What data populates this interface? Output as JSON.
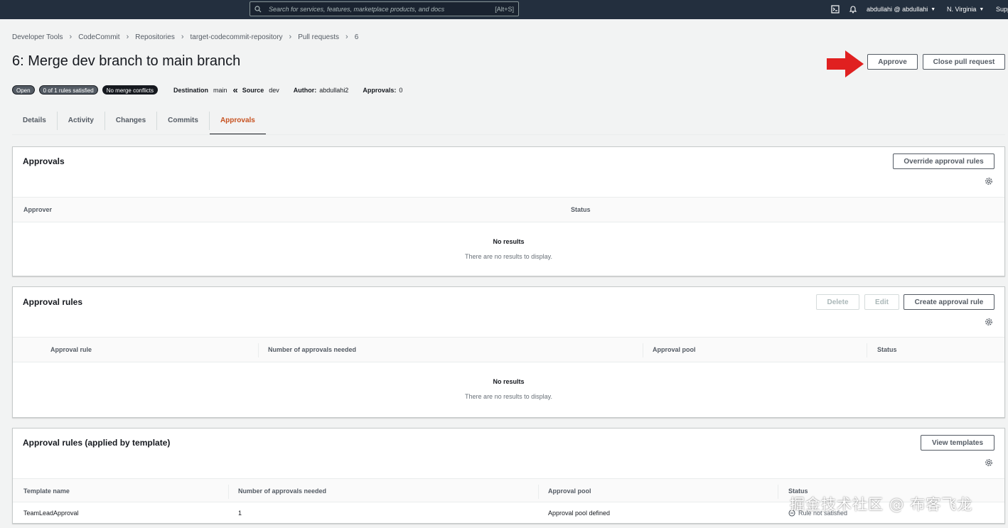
{
  "topnav": {
    "search_placeholder": "Search for services, features, marketplace products, and docs",
    "search_shortcut": "[Alt+S]",
    "account": "abdullahi @ abdullahi",
    "region": "N. Virginia",
    "support": "Supp"
  },
  "breadcrumb": [
    "Developer Tools",
    "CodeCommit",
    "Repositories",
    "target-codecommit-repository",
    "Pull requests",
    "6"
  ],
  "page": {
    "title": "6: Merge dev branch to main branch",
    "approve_label": "Approve",
    "close_label": "Close pull request"
  },
  "status": {
    "open": "Open",
    "rules": "0 of 1 rules satisfied",
    "conflicts": "No merge conflicts",
    "destination_label": "Destination",
    "destination_value": "main",
    "source_label": "Source",
    "source_value": "dev",
    "author_label": "Author:",
    "author_value": "abdullahi2",
    "approvals_label": "Approvals:",
    "approvals_value": "0"
  },
  "tabs": [
    "Details",
    "Activity",
    "Changes",
    "Commits",
    "Approvals"
  ],
  "approvals_panel": {
    "title": "Approvals",
    "override_label": "Override approval rules",
    "columns": [
      "Approver",
      "Status"
    ],
    "empty_title": "No results",
    "empty_sub": "There are no results to display."
  },
  "rules_panel": {
    "title": "Approval rules",
    "delete_label": "Delete",
    "edit_label": "Edit",
    "create_label": "Create approval rule",
    "columns": [
      "Approval rule",
      "Number of approvals needed",
      "Approval pool",
      "Status"
    ],
    "empty_title": "No results",
    "empty_sub": "There are no results to display."
  },
  "template_panel": {
    "title": "Approval rules (applied by template)",
    "view_label": "View templates",
    "columns": [
      "Template name",
      "Number of approvals needed",
      "Approval pool",
      "Status"
    ],
    "row": {
      "template_name": "TeamLeadApproval",
      "approvals_needed": "1",
      "approval_pool": "Approval pool defined",
      "status": "Rule not satisfied"
    }
  },
  "watermark": "掘金技术社区 @ 布客飞龙",
  "colors": {
    "active_tab": "#c7511f",
    "arrow": "#e02020",
    "topnav": "#232f3e"
  }
}
